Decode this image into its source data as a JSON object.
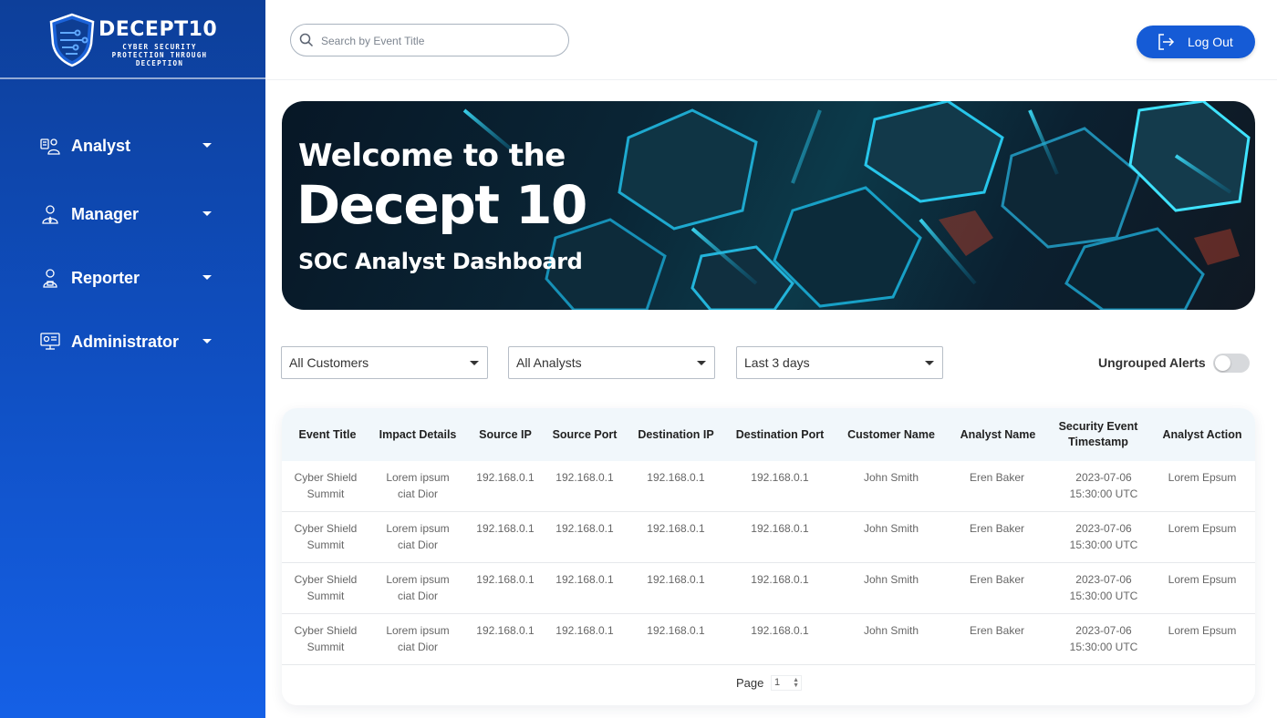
{
  "sidebar": {
    "brand": "DECEPT10",
    "tagline": "CYBER SECURITY PROTECTION THROUGH DECEPTION",
    "items": [
      {
        "label": "Analyst",
        "icon": "analyst-icon"
      },
      {
        "label": "Manager",
        "icon": "manager-icon"
      },
      {
        "label": "Reporter",
        "icon": "reporter-icon"
      },
      {
        "label": "Administrator",
        "icon": "administrator-icon"
      }
    ]
  },
  "header": {
    "search_placeholder": "Search by Event Title",
    "logout_label": "Log Out"
  },
  "banner": {
    "line1": "Welcome to the",
    "line2": "Decept 10",
    "line3": "SOC Analyst Dashboard"
  },
  "filters": {
    "customers": "All Customers",
    "analysts": "All Analysts",
    "range": "Last 3 days",
    "toggle_label": "Ungrouped Alerts",
    "toggle_on": false
  },
  "table": {
    "columns": [
      "Event Title",
      "Impact Details",
      "Source IP",
      "Source Port",
      "Destination IP",
      "Destination Port",
      "Customer Name",
      "Analyst Name",
      "Security Event Timestamp",
      "Analyst Action"
    ],
    "rows": [
      [
        "Cyber Shield Summit",
        "Lorem ipsum ciat Dior",
        "192.168.0.1",
        "192.168.0.1",
        "192.168.0.1",
        "192.168.0.1",
        "John Smith",
        "Eren Baker",
        "2023-07-06 15:30:00 UTC",
        "Lorem Epsum"
      ],
      [
        "Cyber Shield Summit",
        "Lorem ipsum ciat Dior",
        "192.168.0.1",
        "192.168.0.1",
        "192.168.0.1",
        "192.168.0.1",
        "John Smith",
        "Eren Baker",
        "2023-07-06 15:30:00 UTC",
        "Lorem Epsum"
      ],
      [
        "Cyber Shield Summit",
        "Lorem ipsum ciat Dior",
        "192.168.0.1",
        "192.168.0.1",
        "192.168.0.1",
        "192.168.0.1",
        "John Smith",
        "Eren Baker",
        "2023-07-06 15:30:00 UTC",
        "Lorem Epsum"
      ],
      [
        "Cyber Shield Summit",
        "Lorem ipsum ciat Dior",
        "192.168.0.1",
        "192.168.0.1",
        "192.168.0.1",
        "192.168.0.1",
        "John Smith",
        "Eren Baker",
        "2023-07-06 15:30:00 UTC",
        "Lorem Epsum"
      ]
    ],
    "page_label": "Page",
    "page_value": "1"
  },
  "colors": {
    "sidebar_top": "#0d3f9a",
    "sidebar_bottom": "#1560e6",
    "accent": "#155bd6",
    "table_header_bg": "#f1f7fb"
  }
}
